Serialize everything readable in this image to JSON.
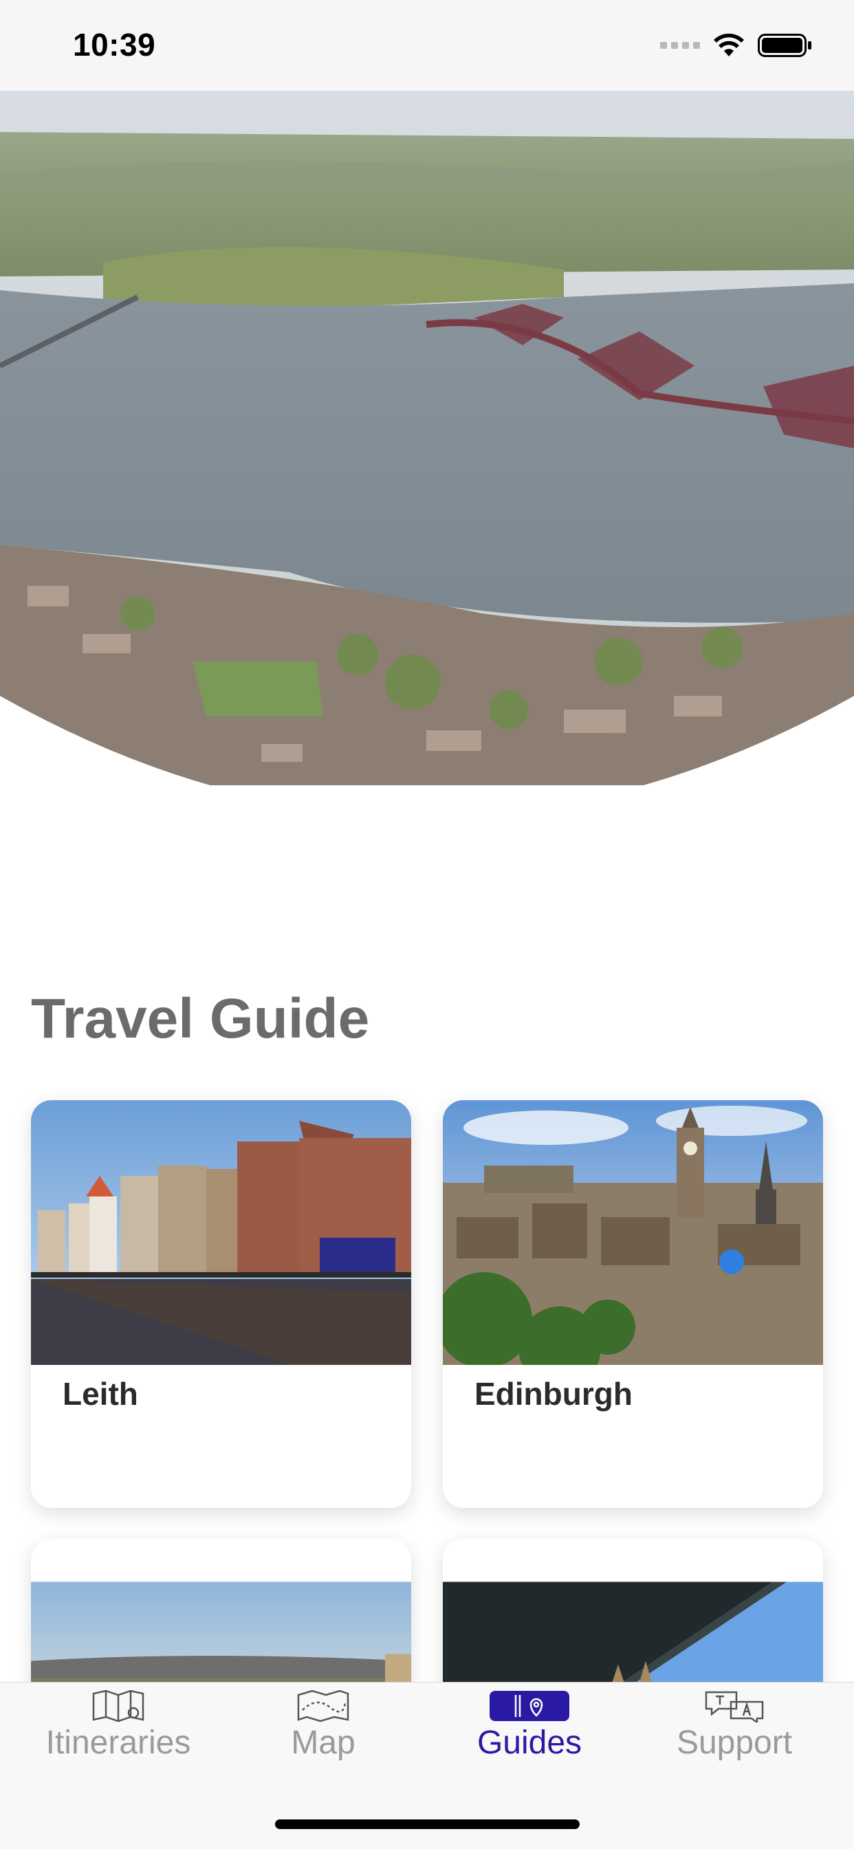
{
  "status_bar": {
    "time": "10:39"
  },
  "main": {
    "title": "Travel Guide",
    "cards": [
      {
        "label": "Leith"
      },
      {
        "label": "Edinburgh"
      },
      {
        "label": ""
      },
      {
        "label": ""
      }
    ]
  },
  "tab_bar": {
    "tabs": [
      {
        "label": "Itineraries",
        "icon": "map-itinerary-icon",
        "active": false
      },
      {
        "label": "Map",
        "icon": "folded-map-icon",
        "active": false
      },
      {
        "label": "Guides",
        "icon": "guide-book-icon",
        "active": true
      },
      {
        "label": "Support",
        "icon": "chat-translate-icon",
        "active": false
      }
    ]
  },
  "colors": {
    "accent": "#2a1aa3",
    "inactive": "#9a9a9e",
    "title": "#6b6b6e"
  }
}
